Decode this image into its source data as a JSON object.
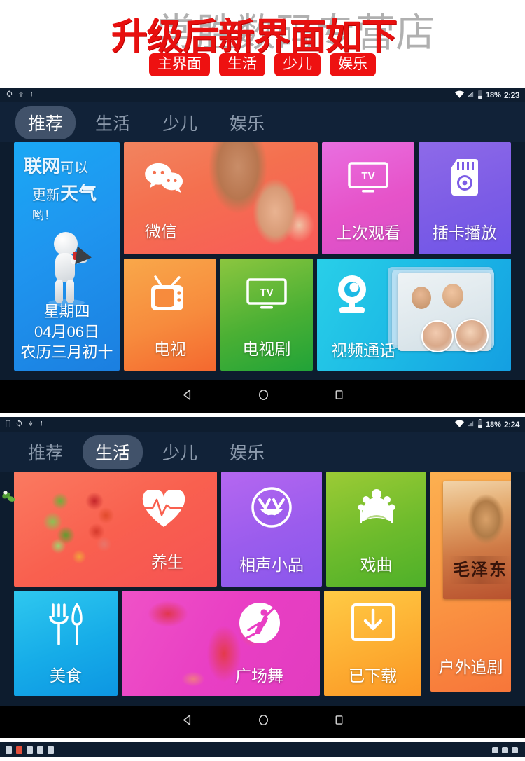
{
  "promo": {
    "title": "升级后新界面如下",
    "watermark": "常胜数码专营店",
    "tags": [
      "主界面",
      "生活",
      "少儿",
      "娱乐"
    ]
  },
  "screens": [
    {
      "id": "screen-home",
      "status_bar": {
        "icons": [
          "sync-icon",
          "usb-icon",
          "usb-debug-icon"
        ],
        "right_icons": [
          "wifi-icon",
          "signal-icon",
          "battery-icon"
        ],
        "battery_percent": "18%",
        "time": "2:23"
      },
      "tabs": [
        {
          "label": "推荐",
          "active": true
        },
        {
          "label": "生活",
          "active": false
        },
        {
          "label": "少儿",
          "active": false
        },
        {
          "label": "娱乐",
          "active": false
        }
      ],
      "weather_tile": {
        "prompt_line1_a": "联网",
        "prompt_line1_b": "可以",
        "prompt_line2_a": "更新",
        "prompt_line2_b": "天气",
        "prompt_line2_c": "哟！",
        "weekday": "星期四",
        "date": "04月06日",
        "lunar": "农历三月初十",
        "icon": "megaphone-figure-icon"
      },
      "tiles": [
        {
          "label": "微信",
          "icon": "wechat-bubbles-icon",
          "color": "#f95a59"
        },
        {
          "label": "上次观看",
          "icon": "tv-monitor-icon",
          "color": "#e653c9"
        },
        {
          "label": "插卡播放",
          "icon": "sdcard-gear-icon",
          "color": "#7c5ce6"
        },
        {
          "label": "电视",
          "icon": "retro-tv-icon",
          "color": "#f78b3d"
        },
        {
          "label": "电视剧",
          "icon": "tv-monitor-icon",
          "color": "#4bb034"
        },
        {
          "label": "视频通话",
          "icon": "webcam-icon",
          "color": "#1cb9e5"
        }
      ],
      "nav_bar": {
        "back": "back-triangle-icon",
        "home": "home-circle-icon",
        "recents": "recents-square-icon"
      }
    },
    {
      "id": "screen-life",
      "status_bar": {
        "icons": [
          "battery-small-icon",
          "sync-icon",
          "usb-icon",
          "usb-debug-icon"
        ],
        "right_icons": [
          "wifi-icon",
          "signal-icon",
          "battery-icon"
        ],
        "battery_percent": "18%",
        "time": "2:24"
      },
      "tabs": [
        {
          "label": "推荐",
          "active": false
        },
        {
          "label": "生活",
          "active": true
        },
        {
          "label": "少儿",
          "active": false
        },
        {
          "label": "娱乐",
          "active": false
        }
      ],
      "tiles": [
        {
          "label": "养生",
          "icon": "heartbeat-icon",
          "color": "#f9604f"
        },
        {
          "label": "相声小品",
          "icon": "laughing-face-icon",
          "color": "#9a5ced"
        },
        {
          "label": "戏曲",
          "icon": "opera-crown-icon",
          "color": "#6dbb2c"
        },
        {
          "label": "户外追剧",
          "icon": "drama-poster-icon",
          "color": "#fa9442",
          "poster_title": "毛泽东"
        },
        {
          "label": "美食",
          "icon": "fork-knife-icon",
          "color": "#16ace8"
        },
        {
          "label": "广场舞",
          "icon": "dancer-circle-icon",
          "color": "#e93fc4"
        },
        {
          "label": "已下载",
          "icon": "download-box-icon",
          "color": "#fdae32"
        }
      ],
      "nav_bar": {
        "back": "back-triangle-icon",
        "home": "home-circle-icon",
        "recents": "recents-square-icon"
      }
    }
  ],
  "colors": {
    "accent_red": "#ee1111",
    "screen_bg": "#0d1c2e",
    "tab_active_bg": "#41526a"
  }
}
